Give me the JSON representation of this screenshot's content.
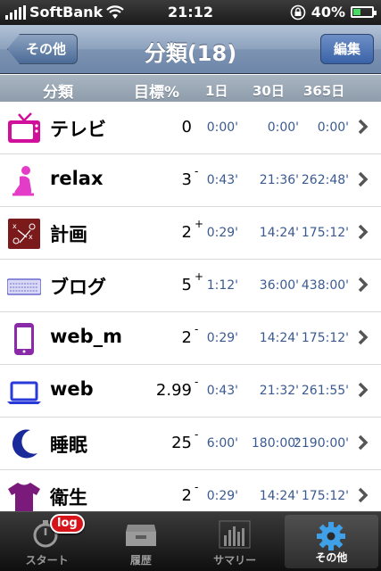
{
  "status": {
    "carrier": "SoftBank",
    "time": "21:12",
    "battery": "40%",
    "battery_level": 0.4
  },
  "nav": {
    "back_label": "その他",
    "title": "分類(18)",
    "edit_label": "編集"
  },
  "columns": {
    "category": "分類",
    "target": "目標%",
    "day1": "1日",
    "day30": "30日",
    "day365": "365日"
  },
  "rows": [
    {
      "name": "テレビ",
      "target": "0",
      "mark": "",
      "d1": "0:00'",
      "d30": "0:00'",
      "d365": "0:00'",
      "icon": "tv-icon"
    },
    {
      "name": "relax",
      "target": "3",
      "mark": "-",
      "d1": "0:43'",
      "d30": "21:36'",
      "d365": "262:48'",
      "icon": "sitting-person-icon"
    },
    {
      "name": "計画",
      "target": "2",
      "mark": "+",
      "d1": "0:29'",
      "d30": "14:24'",
      "d365": "175:12'",
      "icon": "play-diagram-icon"
    },
    {
      "name": "ブログ",
      "target": "5",
      "mark": "+",
      "d1": "1:12'",
      "d30": "36:00'",
      "d365": "438:00'",
      "icon": "keyboard-icon"
    },
    {
      "name": "web_m",
      "target": "2",
      "mark": "-",
      "d1": "0:29'",
      "d30": "14:24'",
      "d365": "175:12'",
      "icon": "phone-icon"
    },
    {
      "name": "web",
      "target": "2.99",
      "mark": "-",
      "d1": "0:43'",
      "d30": "21:32'",
      "d365": "261:55'",
      "icon": "laptop-icon"
    },
    {
      "name": "睡眠",
      "target": "25",
      "mark": "-",
      "d1": "6:00'",
      "d30": "180:00'",
      "d365": "2190:00'",
      "icon": "moon-icon"
    },
    {
      "name": "衛生",
      "target": "2",
      "mark": "-",
      "d1": "0:29'",
      "d30": "14:24'",
      "d365": "175:12'",
      "icon": "tshirt-icon"
    }
  ],
  "tabs": [
    {
      "label": "スタート",
      "badge": "log",
      "icon": "stopwatch-icon"
    },
    {
      "label": "履歴",
      "icon": "inbox-tray-icon"
    },
    {
      "label": "サマリー",
      "icon": "bar-chart-icon"
    },
    {
      "label": "その他",
      "icon": "gear-icon",
      "active": true
    }
  ]
}
